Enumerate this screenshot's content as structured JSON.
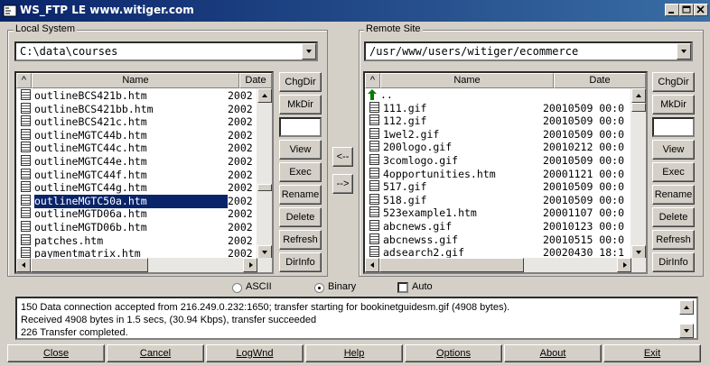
{
  "window": {
    "title": "WS_FTP LE www.witiger.com"
  },
  "local": {
    "group_label": "Local System",
    "path": "C:\\data\\courses",
    "col_name": "Name",
    "col_date": "Date",
    "files": [
      {
        "name": "outlineBCS421b.htm",
        "date": "2002"
      },
      {
        "name": "outlineBCS421bb.htm",
        "date": "2002"
      },
      {
        "name": "outlineBCS421c.htm",
        "date": "2002"
      },
      {
        "name": "outlineMGTC44b.htm",
        "date": "2002"
      },
      {
        "name": "outlineMGTC44c.htm",
        "date": "2002"
      },
      {
        "name": "outlineMGTC44e.htm",
        "date": "2002"
      },
      {
        "name": "outlineMGTC44f.htm",
        "date": "2002"
      },
      {
        "name": "outlineMGTC44g.htm",
        "date": "2002"
      },
      {
        "name": "outlineMGTC50a.htm",
        "date": "2002"
      },
      {
        "name": "outlineMGTD06a.htm",
        "date": "2002"
      },
      {
        "name": "outlineMGTD06b.htm",
        "date": "2002"
      },
      {
        "name": "patches.htm",
        "date": "2002"
      },
      {
        "name": "paymentmatrix.htm",
        "date": "2002"
      }
    ],
    "selected_index": 8,
    "buttons": [
      "ChgDir",
      "MkDir",
      "View",
      "Exec",
      "Rename",
      "Delete",
      "Refresh",
      "DirInfo"
    ]
  },
  "remote": {
    "group_label": "Remote Site",
    "path": "/usr/www/users/witiger/ecommerce",
    "col_name": "Name",
    "col_date": "Date",
    "parent": "..",
    "files": [
      {
        "name": "111.gif",
        "date": "20010509 00:0"
      },
      {
        "name": "112.gif",
        "date": "20010509 00:0"
      },
      {
        "name": "1wel2.gif",
        "date": "20010509 00:0"
      },
      {
        "name": "200logo.gif",
        "date": "20010212 00:0"
      },
      {
        "name": "3comlogo.gif",
        "date": "20010509 00:0"
      },
      {
        "name": "4opportunities.htm",
        "date": "20001121 00:0"
      },
      {
        "name": "517.gif",
        "date": "20010509 00:0"
      },
      {
        "name": "518.gif",
        "date": "20010509 00:0"
      },
      {
        "name": "523example1.htm",
        "date": "20001107 00:0"
      },
      {
        "name": "abcnews.gif",
        "date": "20010123 00:0"
      },
      {
        "name": "abcnewss.gif",
        "date": "20010515 00:0"
      },
      {
        "name": "adsearch2.gif",
        "date": "20020430 18:1"
      }
    ],
    "buttons": [
      "ChgDir",
      "MkDir",
      "View",
      "Exec",
      "Rename",
      "Delete",
      "Refresh",
      "DirInfo"
    ]
  },
  "transfer": {
    "to_local": "<--",
    "to_remote": "-->"
  },
  "mode": {
    "ascii": "ASCII",
    "binary": "Binary",
    "auto": "Auto",
    "selected": "Binary",
    "auto_checked": false
  },
  "log": [
    "150 Data connection accepted from 216.249.0.232:1650; transfer starting for bookinetguidesm.gif (4908 bytes).",
    "Received 4908 bytes in 1.5 secs, (30.94 Kbps), transfer succeeded",
    "226 Transfer completed."
  ],
  "bottom_buttons": [
    "Close",
    "Cancel",
    "LogWnd",
    "Help",
    "Options",
    "About",
    "Exit"
  ],
  "colors": {
    "title_start": "#0a246a",
    "title_end": "#3a6ea5",
    "selection": "#0a246a",
    "face": "#d4d0c8"
  }
}
